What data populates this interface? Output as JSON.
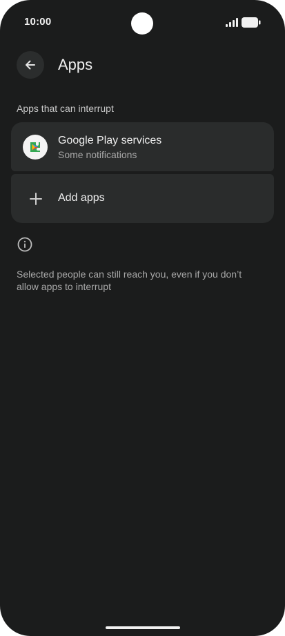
{
  "status_bar": {
    "time": "10:00"
  },
  "header": {
    "back_icon": "arrow-back-icon",
    "title": "Apps"
  },
  "section": {
    "title": "Apps that can interrupt"
  },
  "apps": [
    {
      "name": "Google Play services",
      "subtitle": "Some notifications",
      "icon": "google-play-services-icon"
    }
  ],
  "add_apps": {
    "icon": "plus-icon",
    "label": "Add apps"
  },
  "info": {
    "icon": "info-icon",
    "text": "Selected people can still reach you, even if you don’t allow apps to interrupt"
  },
  "colors": {
    "background": "#1b1c1c",
    "card": "#2a2c2c",
    "text_primary": "#eeeeee",
    "text_secondary": "#a8a8a8"
  }
}
